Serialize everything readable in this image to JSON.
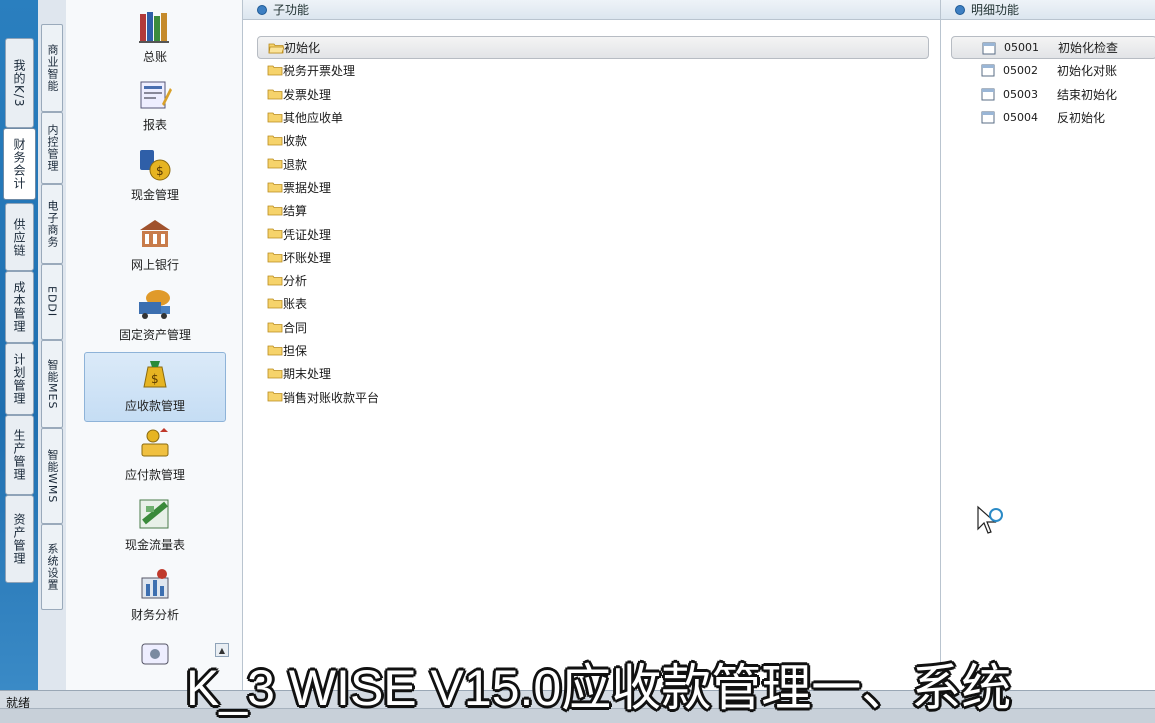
{
  "outer_tabs": [
    {
      "label": "我的K/3",
      "active": false
    },
    {
      "label": "财务会计",
      "active": true
    },
    {
      "label": "供应链",
      "active": false
    },
    {
      "label": "成本管理",
      "active": false
    },
    {
      "label": "计划管理",
      "active": false
    },
    {
      "label": "生产管理",
      "active": false
    },
    {
      "label": "资产管理",
      "active": false
    }
  ],
  "inner_tabs": [
    {
      "label": "商业智能"
    },
    {
      "label": "内控管理"
    },
    {
      "label": "电子商务"
    },
    {
      "label": "EDDI"
    },
    {
      "label": "智能MES"
    },
    {
      "label": "智能WMS"
    },
    {
      "label": "系统设置"
    }
  ],
  "modules": [
    {
      "label": "总账",
      "icon": "ledger-books-icon"
    },
    {
      "label": "报表",
      "icon": "report-icon"
    },
    {
      "label": "现金管理",
      "icon": "cash-management-icon"
    },
    {
      "label": "网上银行",
      "icon": "online-bank-icon"
    },
    {
      "label": "固定资产管理",
      "icon": "fixed-assets-truck-icon"
    },
    {
      "label": "应收款管理",
      "icon": "receivables-moneybag-icon",
      "active": true
    },
    {
      "label": "应付款管理",
      "icon": "payables-icon"
    },
    {
      "label": "现金流量表",
      "icon": "cashflow-statement-icon"
    },
    {
      "label": "财务分析",
      "icon": "financial-analysis-icon"
    },
    {
      "label": "",
      "icon": "more-module-icon"
    }
  ],
  "sub_pane": {
    "title": "子功能",
    "items": [
      "初始化",
      "税务开票处理",
      "发票处理",
      "其他应收单",
      "收款",
      "退款",
      "票据处理",
      "结算",
      "凭证处理",
      "坏账处理",
      "分析",
      "账表",
      "合同",
      "担保",
      "期末处理",
      "销售对账收款平台"
    ],
    "selected_index": 0
  },
  "detail_pane": {
    "title": "明细功能",
    "items": [
      {
        "code": "05001",
        "name": "初始化检查"
      },
      {
        "code": "05002",
        "name": "初始化对账"
      },
      {
        "code": "05003",
        "name": "结束初始化"
      },
      {
        "code": "05004",
        "name": "反初始化"
      }
    ],
    "selected_index": 0
  },
  "status": {
    "text": "就绪"
  },
  "subtitle": {
    "text": "K_3 WISE V15.0应收款管理一、系统"
  },
  "colors": {
    "accent": "#1f6fb0",
    "selected_module": "#c5ddf4",
    "folder": "#f2c94c"
  }
}
